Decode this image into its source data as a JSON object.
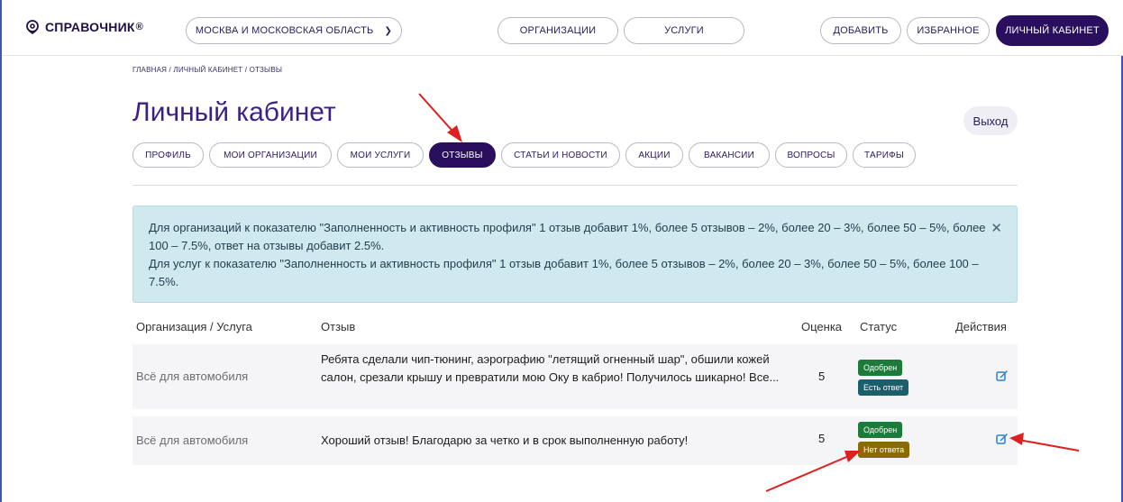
{
  "header": {
    "logo_text": "СПРАВОЧНИК",
    "logo_mark": "®",
    "region_label": "МОСКВА И МОСКОВСКАЯ ОБЛАСТЬ",
    "nav_organizations": "ОРГАНИЗАЦИИ",
    "nav_services": "УСЛУГИ",
    "add_label": "ДОБАВИТЬ",
    "favorites_label": "ИЗБРАННОЕ",
    "cabinet_label": "ЛИЧНЫЙ КАБИНЕТ"
  },
  "breadcrumb": "ГЛАВНАЯ / ЛИЧНЫЙ КАБИНЕТ / ОТЗЫВЫ",
  "page_title": "Личный кабинет",
  "logout_label": "Выход",
  "tabs": [
    {
      "label": "ПРОФИЛЬ"
    },
    {
      "label": "МОИ ОРГАНИЗАЦИИ"
    },
    {
      "label": "МОИ УСЛУГИ"
    },
    {
      "label": "ОТЗЫВЫ",
      "active": true
    },
    {
      "label": "СТАТЬИ И НОВОСТИ"
    },
    {
      "label": "АКЦИИ"
    },
    {
      "label": "ВАКАНСИИ"
    },
    {
      "label": "ВОПРОСЫ"
    },
    {
      "label": "ТАРИФЫ"
    }
  ],
  "alert": {
    "line1": "Для организаций к показателю \"Заполненность и активность профиля\" 1 отзыв добавит 1%, более 5 отзывов – 2%, более 20 – 3%, более 50 – 5%, более 100 – 7.5%, ответ на отзывы добавит 2.5%.",
    "line2": "Для услуг к показателю \"Заполненность и активность профиля\" 1 отзыв добавит 1%, более 5 отзывов – 2%, более 20 – 3%, более 50 – 5%, более 100 – 7.5%.",
    "close": "✕"
  },
  "table": {
    "headers": {
      "org": "Организация / Услуга",
      "review": "Отзыв",
      "rating": "Оценка",
      "status": "Статус",
      "actions": "Действия"
    },
    "rows": [
      {
        "org": "Всё для автомобиля",
        "review": "Ребята сделали чип-тюнинг, аэрографию \"летящий огненный шар\", обшили кожей салон, срезали крышу и превратили мою Оку в кабрио! Получилось шикарно! Все...",
        "rating": "5",
        "status": "Одобрен",
        "reply": "Есть ответ"
      },
      {
        "org": "Всё для автомобиля",
        "review": "Хороший отзыв! Благодарю за четко и в срок выполненную работу!",
        "rating": "5",
        "status": "Одобрен",
        "reply": "Нет ответа"
      }
    ]
  },
  "colors": {
    "brand": "#2a0f5e",
    "title": "#3b1f86",
    "alert_bg": "#cfe9ef",
    "approved": "#1e7a3a",
    "has_reply": "#1b5e6c",
    "no_reply": "#8a6a05",
    "annotation_arrow": "#e02020",
    "edit_icon": "#2f7fd1"
  },
  "icons": {
    "logo": "location-pin-icon",
    "region_dropdown": "chevron-down-icon",
    "alert_close": "close-icon",
    "edit": "edit-icon"
  }
}
